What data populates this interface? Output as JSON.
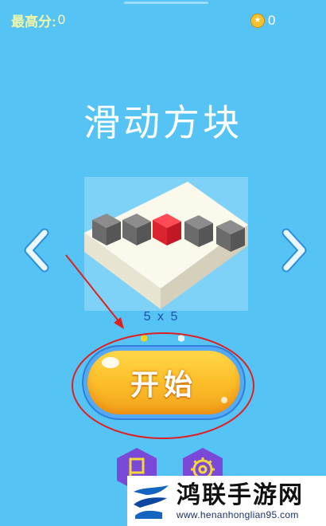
{
  "hud": {
    "best_score_label": "最高分:",
    "best_score_value": "0",
    "coin_icon": "star-coin-icon",
    "coins": "0"
  },
  "title": "滑动方块",
  "level_select": {
    "size_label": "5 x 5",
    "prev_icon": "chevron-left-icon",
    "next_icon": "chevron-right-icon",
    "active_dot_color": "#f3d21c",
    "inactive_dot_color": "#e8f2f7"
  },
  "start_button": {
    "label": "开始",
    "color": "#fcc12b"
  },
  "bottom_buttons": [
    {
      "icon": "flag-icon"
    },
    {
      "icon": "gear-icon"
    }
  ],
  "colors": {
    "background": "#56c3f5",
    "annotation": "#e02020",
    "hex_button": "#7a49d8"
  },
  "watermark": {
    "title": "鸿联手游网",
    "url": "www.henanhonglian95.com"
  }
}
